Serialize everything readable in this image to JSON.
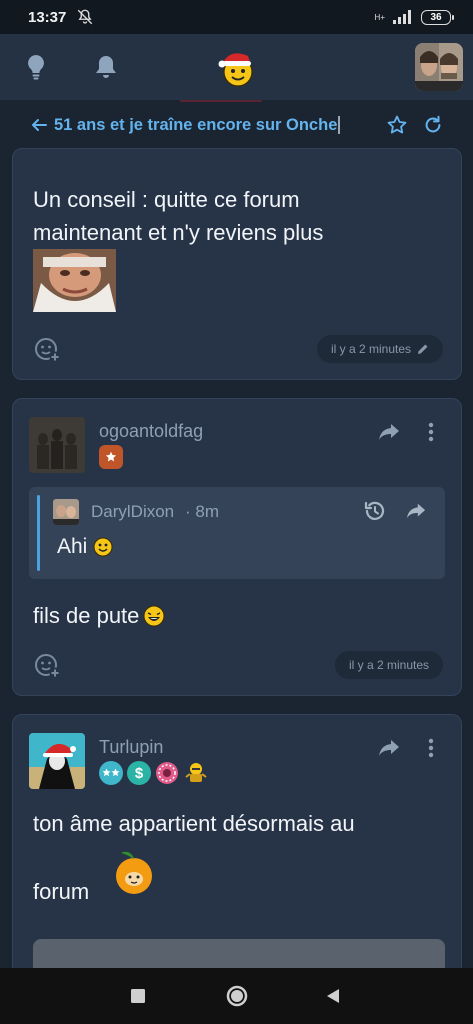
{
  "status": {
    "time": "13:37",
    "battery": "36",
    "network": "H+"
  },
  "header": {
    "icons": [
      "lightbulb-icon",
      "bell-icon",
      "santa-smiley-logo",
      "user-avatar"
    ]
  },
  "topic": {
    "title": "51 ans et je traîne encore sur Onche"
  },
  "posts": [
    {
      "text_line1": "Un conseil : quitte ce forum",
      "text_line2": "maintenant et n'y reviens plus",
      "time": "il y a 2 minutes"
    },
    {
      "author": "ogoantoldfag",
      "quote": {
        "author": "DarylDixon",
        "age": "· 8m",
        "text": "Ahi"
      },
      "text": "fils de pute",
      "time": "il y a 2 minutes"
    },
    {
      "author": "Turlupin",
      "text_line1": "ton âme appartient désormais au",
      "text_line2": "forum"
    }
  ],
  "colors": {
    "accent": "#63b3ed",
    "card": "#273447",
    "background": "#1b2431"
  }
}
